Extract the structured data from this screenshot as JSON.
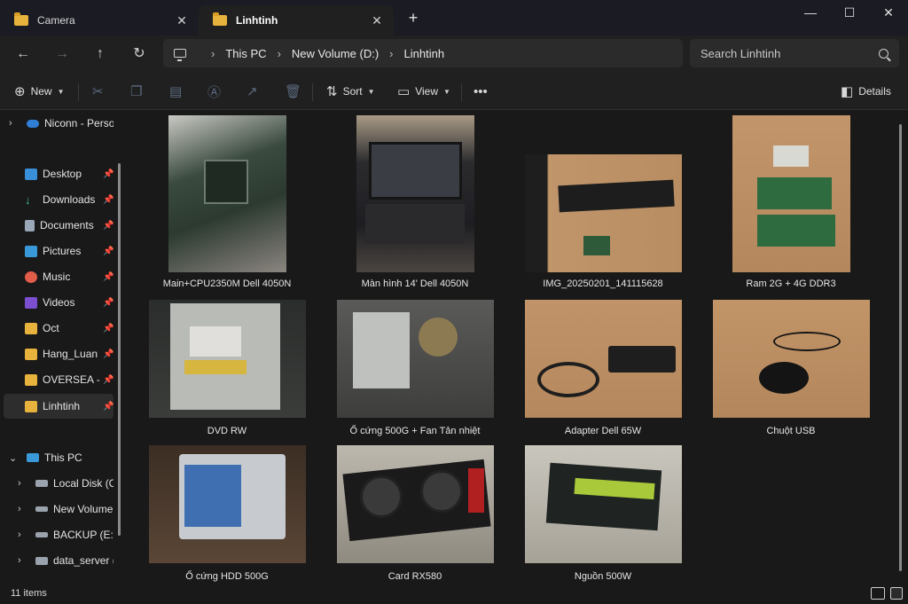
{
  "tabs": [
    {
      "label": "Camera",
      "icon": "folder-icon"
    },
    {
      "label": "Linhtinh",
      "icon": "folder-icon"
    }
  ],
  "address": {
    "crumbs": [
      "This PC",
      "New Volume (D:)",
      "Linhtinh"
    ]
  },
  "search": {
    "placeholder": "Search Linhtinh"
  },
  "toolbar": {
    "new_label": "New",
    "sort_label": "Sort",
    "view_label": "View",
    "details_label": "Details"
  },
  "sidebar": {
    "items": [
      {
        "label": "Niconn - Personal",
        "icon": "cloud-icon",
        "pinned": false
      },
      {
        "label": "Desktop",
        "icon": "desktop-icon",
        "pinned": true
      },
      {
        "label": "Downloads",
        "icon": "download-icon",
        "pinned": true
      },
      {
        "label": "Documents",
        "icon": "documents-icon",
        "pinned": true
      },
      {
        "label": "Pictures",
        "icon": "pictures-icon",
        "pinned": true
      },
      {
        "label": "Music",
        "icon": "music-icon",
        "pinned": true
      },
      {
        "label": "Videos",
        "icon": "videos-icon",
        "pinned": true
      },
      {
        "label": "Oct",
        "icon": "folder-icon",
        "pinned": true
      },
      {
        "label": "Hang_Luan",
        "icon": "folder-icon",
        "pinned": true
      },
      {
        "label": "OVERSEA - C",
        "icon": "folder-icon",
        "pinned": true
      },
      {
        "label": "Linhtinh",
        "icon": "folder-icon",
        "pinned": true
      },
      {
        "label": "This PC",
        "icon": "this-pc-icon",
        "pinned": false
      },
      {
        "label": "Local Disk (C:)",
        "icon": "drive-icon",
        "pinned": false
      },
      {
        "label": "New Volume (D:)",
        "icon": "drive-icon",
        "pinned": false
      },
      {
        "label": "BACKUP (E:)",
        "icon": "drive-icon",
        "pinned": false
      },
      {
        "label": "data_server (\\\\",
        "icon": "network-drive-icon",
        "pinned": false
      }
    ]
  },
  "files": [
    {
      "name": "Main+CPU2350M Dell 4050N"
    },
    {
      "name": "Màn hình 14' Dell 4050N"
    },
    {
      "name": "IMG_20250201_141115628"
    },
    {
      "name": "Ram 2G + 4G DDR3"
    },
    {
      "name": "DVD RW"
    },
    {
      "name": "Ổ cứng 500G + Fan Tản nhiệt"
    },
    {
      "name": "Adapter Dell 65W"
    },
    {
      "name": "Chuột USB"
    },
    {
      "name": "Ổ cứng HDD 500G"
    },
    {
      "name": "Card RX580"
    },
    {
      "name": "Nguồn 500W"
    }
  ],
  "status": {
    "item_count": "11 items"
  },
  "colors": {
    "accent": "#e8b33c",
    "background": "#191919",
    "chrome": "#202020"
  }
}
